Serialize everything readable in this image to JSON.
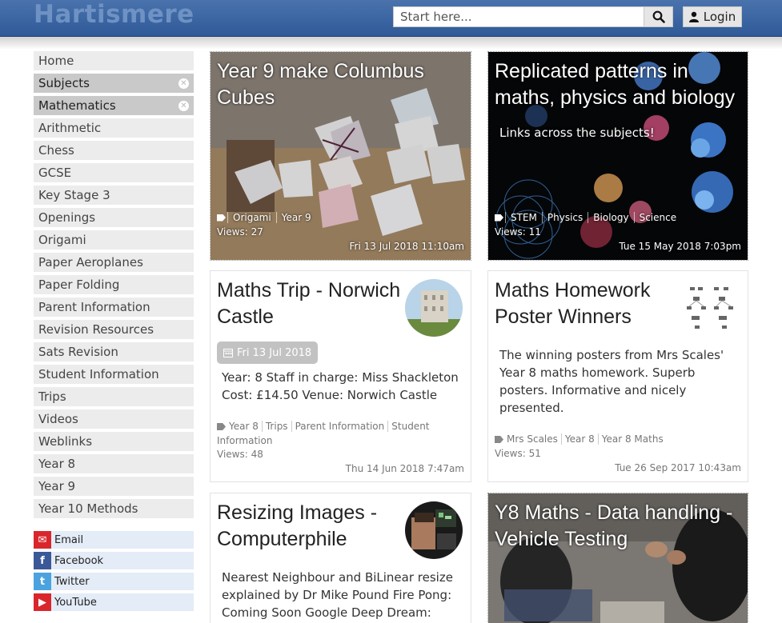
{
  "header": {
    "brand": "Hartismere",
    "search_placeholder": "Start here...",
    "login_label": "Login"
  },
  "sidebar": {
    "items": [
      {
        "label": "Home",
        "active": false
      },
      {
        "label": "Subjects",
        "active": true
      },
      {
        "label": "Mathematics",
        "active": true
      },
      {
        "label": "Arithmetic",
        "active": false
      },
      {
        "label": "Chess",
        "active": false
      },
      {
        "label": "GCSE",
        "active": false
      },
      {
        "label": "Key Stage 3",
        "active": false
      },
      {
        "label": "Openings",
        "active": false
      },
      {
        "label": "Origami",
        "active": false
      },
      {
        "label": "Paper Aeroplanes",
        "active": false
      },
      {
        "label": "Paper Folding",
        "active": false
      },
      {
        "label": "Parent Information",
        "active": false
      },
      {
        "label": "Revision Resources",
        "active": false
      },
      {
        "label": "Sats Revision",
        "active": false
      },
      {
        "label": "Student Information",
        "active": false
      },
      {
        "label": "Trips",
        "active": false
      },
      {
        "label": "Videos",
        "active": false
      },
      {
        "label": "Weblinks",
        "active": false
      },
      {
        "label": "Year 8",
        "active": false
      },
      {
        "label": "Year 9",
        "active": false
      },
      {
        "label": "Year 10 Methods",
        "active": false
      }
    ],
    "social": [
      {
        "label": "Email",
        "icon": "email-icon",
        "color": "#d9262c"
      },
      {
        "label": "Facebook",
        "icon": "facebook-icon",
        "color": "#3b5998"
      },
      {
        "label": "Twitter",
        "icon": "twitter-icon",
        "color": "#4aa3df"
      },
      {
        "label": "YouTube",
        "icon": "youtube-icon",
        "color": "#d9262c"
      }
    ]
  },
  "cards": {
    "columbus": {
      "title": "Year 9 make Columbus Cubes",
      "tags": [
        "Origami",
        "Year 9"
      ],
      "views": "Views: 27",
      "date": "Fri 13 Jul 2018 11:10am"
    },
    "patterns": {
      "title": "Replicated patterns in maths, physics and biology",
      "subtitle": "Links across the subjects!",
      "tags": [
        "STEM",
        "Physics",
        "Biology",
        "Science"
      ],
      "views": "Views: 11",
      "date": "Tue 15 May 2018 7:03pm"
    },
    "trip": {
      "title": "Maths Trip - Norwich Castle",
      "badge": "Fri 13 Jul 2018",
      "body": "Year: 8 Staff in charge: Miss Shackleton Cost: £14.50 Venue: Norwich Castle",
      "tags_line1": [
        "Year 8",
        "Trips",
        "Parent Information",
        "Student"
      ],
      "tags_line2": "Information",
      "views": "Views: 48",
      "date": "Thu 14 Jun 2018 7:47am"
    },
    "homework": {
      "title": "Maths Homework Poster Winners",
      "body": "The winning posters from Mrs Scales' Year 8 maths homework.  Superb posters.  Informative and nicely presented.",
      "tags": [
        "Mrs Scales",
        "Year 8",
        "Year 8 Maths"
      ],
      "views": "Views: 51",
      "date": "Tue 26 Sep 2017 10:43am"
    },
    "resizing": {
      "title": "Resizing Images - Computerphile",
      "body": "Nearest Neighbour and BiLinear resize explained by Dr Mike Pound Fire Pong: Coming Soon Google Deep Dream:"
    },
    "vehicle": {
      "title": "Y8 Maths - Data handling - Vehicle Testing"
    }
  },
  "colors": {
    "header": "#3a65a4",
    "nav_bg": "#ececec",
    "nav_active": "#c9c9c9",
    "badge": "#c2c2c2"
  }
}
